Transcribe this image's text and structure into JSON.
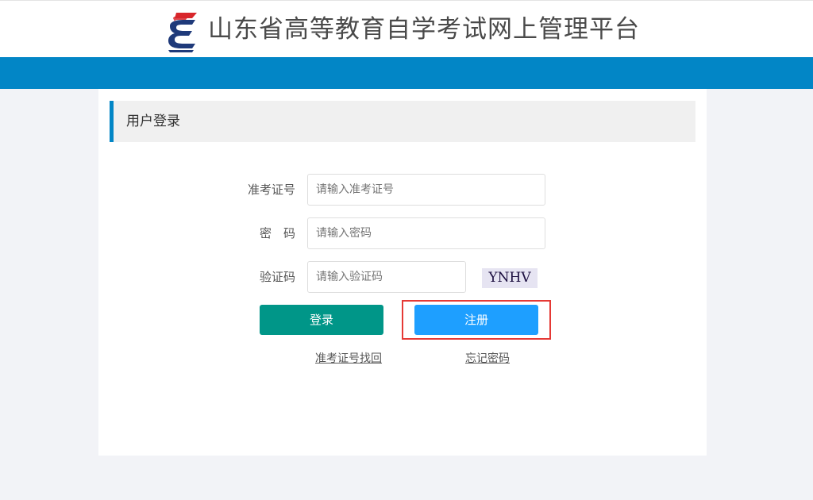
{
  "header": {
    "site_title": "山东省高等教育自学考试网上管理平台",
    "logo_icon": "sd-exam-logo-icon"
  },
  "colors": {
    "brand_blue": "#0286c6",
    "login_button": "#009688",
    "register_button": "#1e9fff",
    "highlight": "#e53935"
  },
  "login_panel": {
    "title": "用户登录",
    "fields": {
      "exam_id": {
        "label": "准考证号",
        "placeholder": "请输入准考证号",
        "value": ""
      },
      "password": {
        "label": "密　码",
        "placeholder": "请输入密码",
        "value": ""
      },
      "captcha": {
        "label": "验证码",
        "placeholder": "请输入验证码",
        "value": "",
        "image_text": "YNHV"
      }
    },
    "buttons": {
      "login": "登录",
      "register": "注册"
    },
    "links": {
      "retrieve_exam_id": "准考证号找回",
      "forgot_password": "忘记密码"
    }
  }
}
